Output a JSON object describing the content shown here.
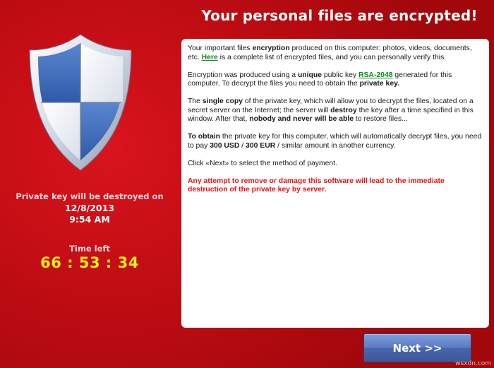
{
  "window": {
    "title": "Your personal files are encrypted!"
  },
  "colors": {
    "background": "#c10d14",
    "countdown": "#f7ee1e",
    "link": "#0b8a1a",
    "warning": "#e41212",
    "button": "#5a7cc4"
  },
  "sidebar": {
    "shield_icon": "shield-icon",
    "destroy_label": "Private key will be destroyed on",
    "destroy_date": "12/8/2013",
    "destroy_time": "9:54 AM",
    "time_left_label": "Time left",
    "countdown": "66 : 53 : 34"
  },
  "message": {
    "p1": {
      "t1": "Your important files ",
      "b1": "encryption",
      "t2": " produced on this computer: photos, videos, documents, etc. ",
      "link": "Here",
      "t3": " is a complete list of encrypted files, and you can personally verify this."
    },
    "p2": {
      "t1": "Encryption was produced using a ",
      "b1": "unique",
      "t2": " public key ",
      "link": "RSA-2048",
      "t3": " generated for this computer. To decrypt the files you need to obtain the ",
      "b2": "private key."
    },
    "p3": {
      "t1": "The ",
      "b1": "single copy",
      "t2": " of the private key, which will allow you to decrypt the files, located on a secret server on the Internet; the server will ",
      "b2": "destroy",
      "t3": " the key after a time specified in this window. After that, ",
      "b3": "nobody and never will be able",
      "t4": " to restore files..."
    },
    "p4": {
      "b1": "To obtain",
      "t1": " the private key for this computer, which will automatically decrypt files, you need to pay ",
      "b2": "300 USD",
      "t2": " / ",
      "b3": "300 EUR",
      "t3": " / similar amount in another currency."
    },
    "p5": "Click «Next» to select the method of payment.",
    "warning": "Any attempt to remove or damage this software will lead to the immediate destruction of the private key by server."
  },
  "footer": {
    "next_label": "Next >>",
    "watermark": "wsxdn.com"
  }
}
